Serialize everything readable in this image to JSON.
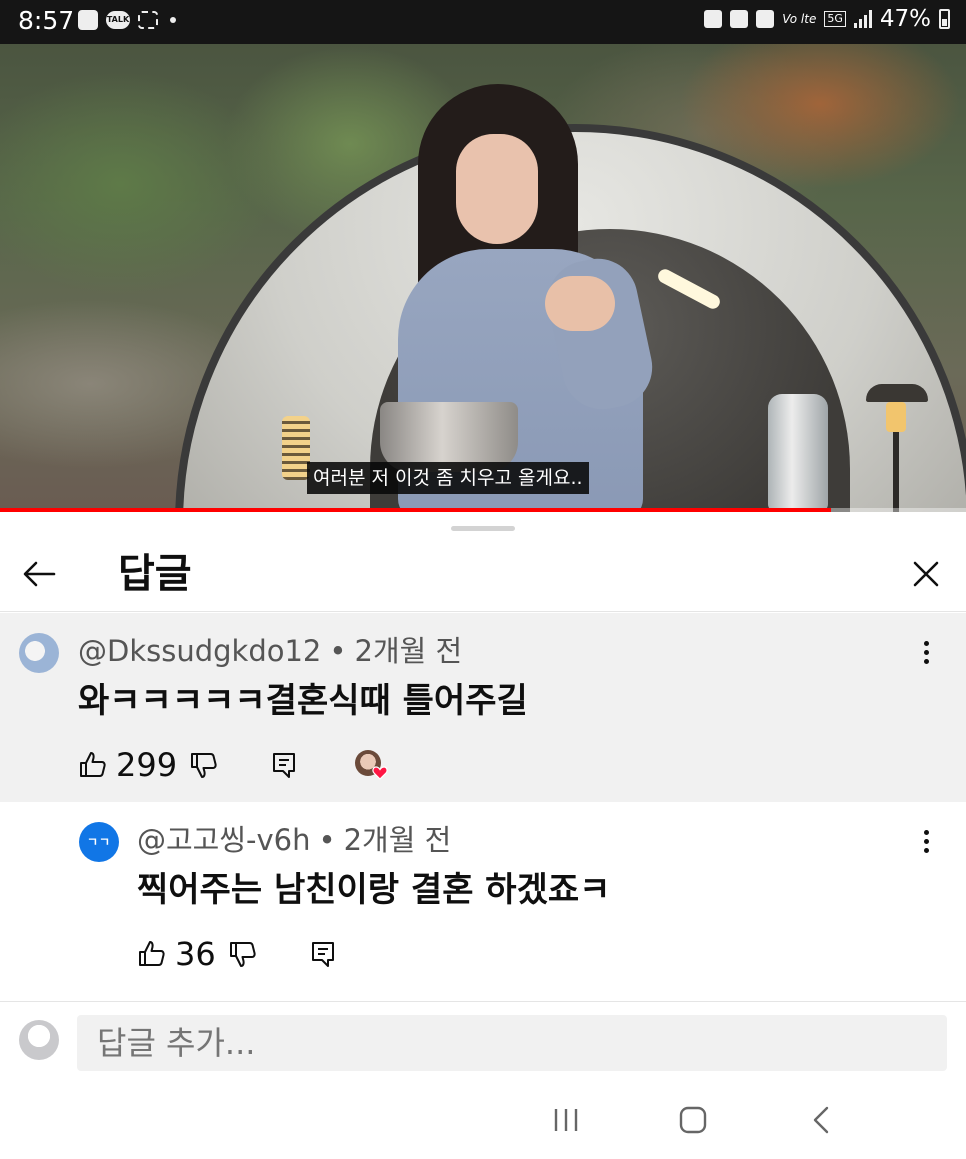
{
  "status_bar": {
    "time": "8:57",
    "talk_badge": "TALK",
    "volte": "Vo lte",
    "network": "5G",
    "battery": "47%"
  },
  "video": {
    "subtitle": "여러분 저 이것 좀 치우고 올게요..",
    "progress_fraction": 0.86
  },
  "sheet": {
    "title": "답글"
  },
  "parent_comment": {
    "author": "@Dkssudgkdo12",
    "time": "2개월 전",
    "text": "와ㅋㅋㅋㅋㅋ결혼식때 틀어주길",
    "likes": "299",
    "creator_hearted": true
  },
  "reply_comment": {
    "avatar_text": "ㄱㄱ",
    "author": "@고고씽-v6h",
    "time": "2개월 전",
    "text": "찍어주는 남친이랑 결혼 하겠죠ㅋ",
    "likes": "36"
  },
  "add_reply": {
    "placeholder": "답글 추가..."
  },
  "colors": {
    "progress": "#ff0000",
    "heart": "#ff1744",
    "reply_avatar": "#1176e6",
    "parent_background": "#f1f1f1"
  },
  "icons": [
    "back-arrow-icon",
    "close-icon",
    "like-icon",
    "dislike-icon",
    "reply-icon",
    "more-vert-icon",
    "heart-icon",
    "recents-icon",
    "home-icon",
    "back-nav-icon"
  ]
}
